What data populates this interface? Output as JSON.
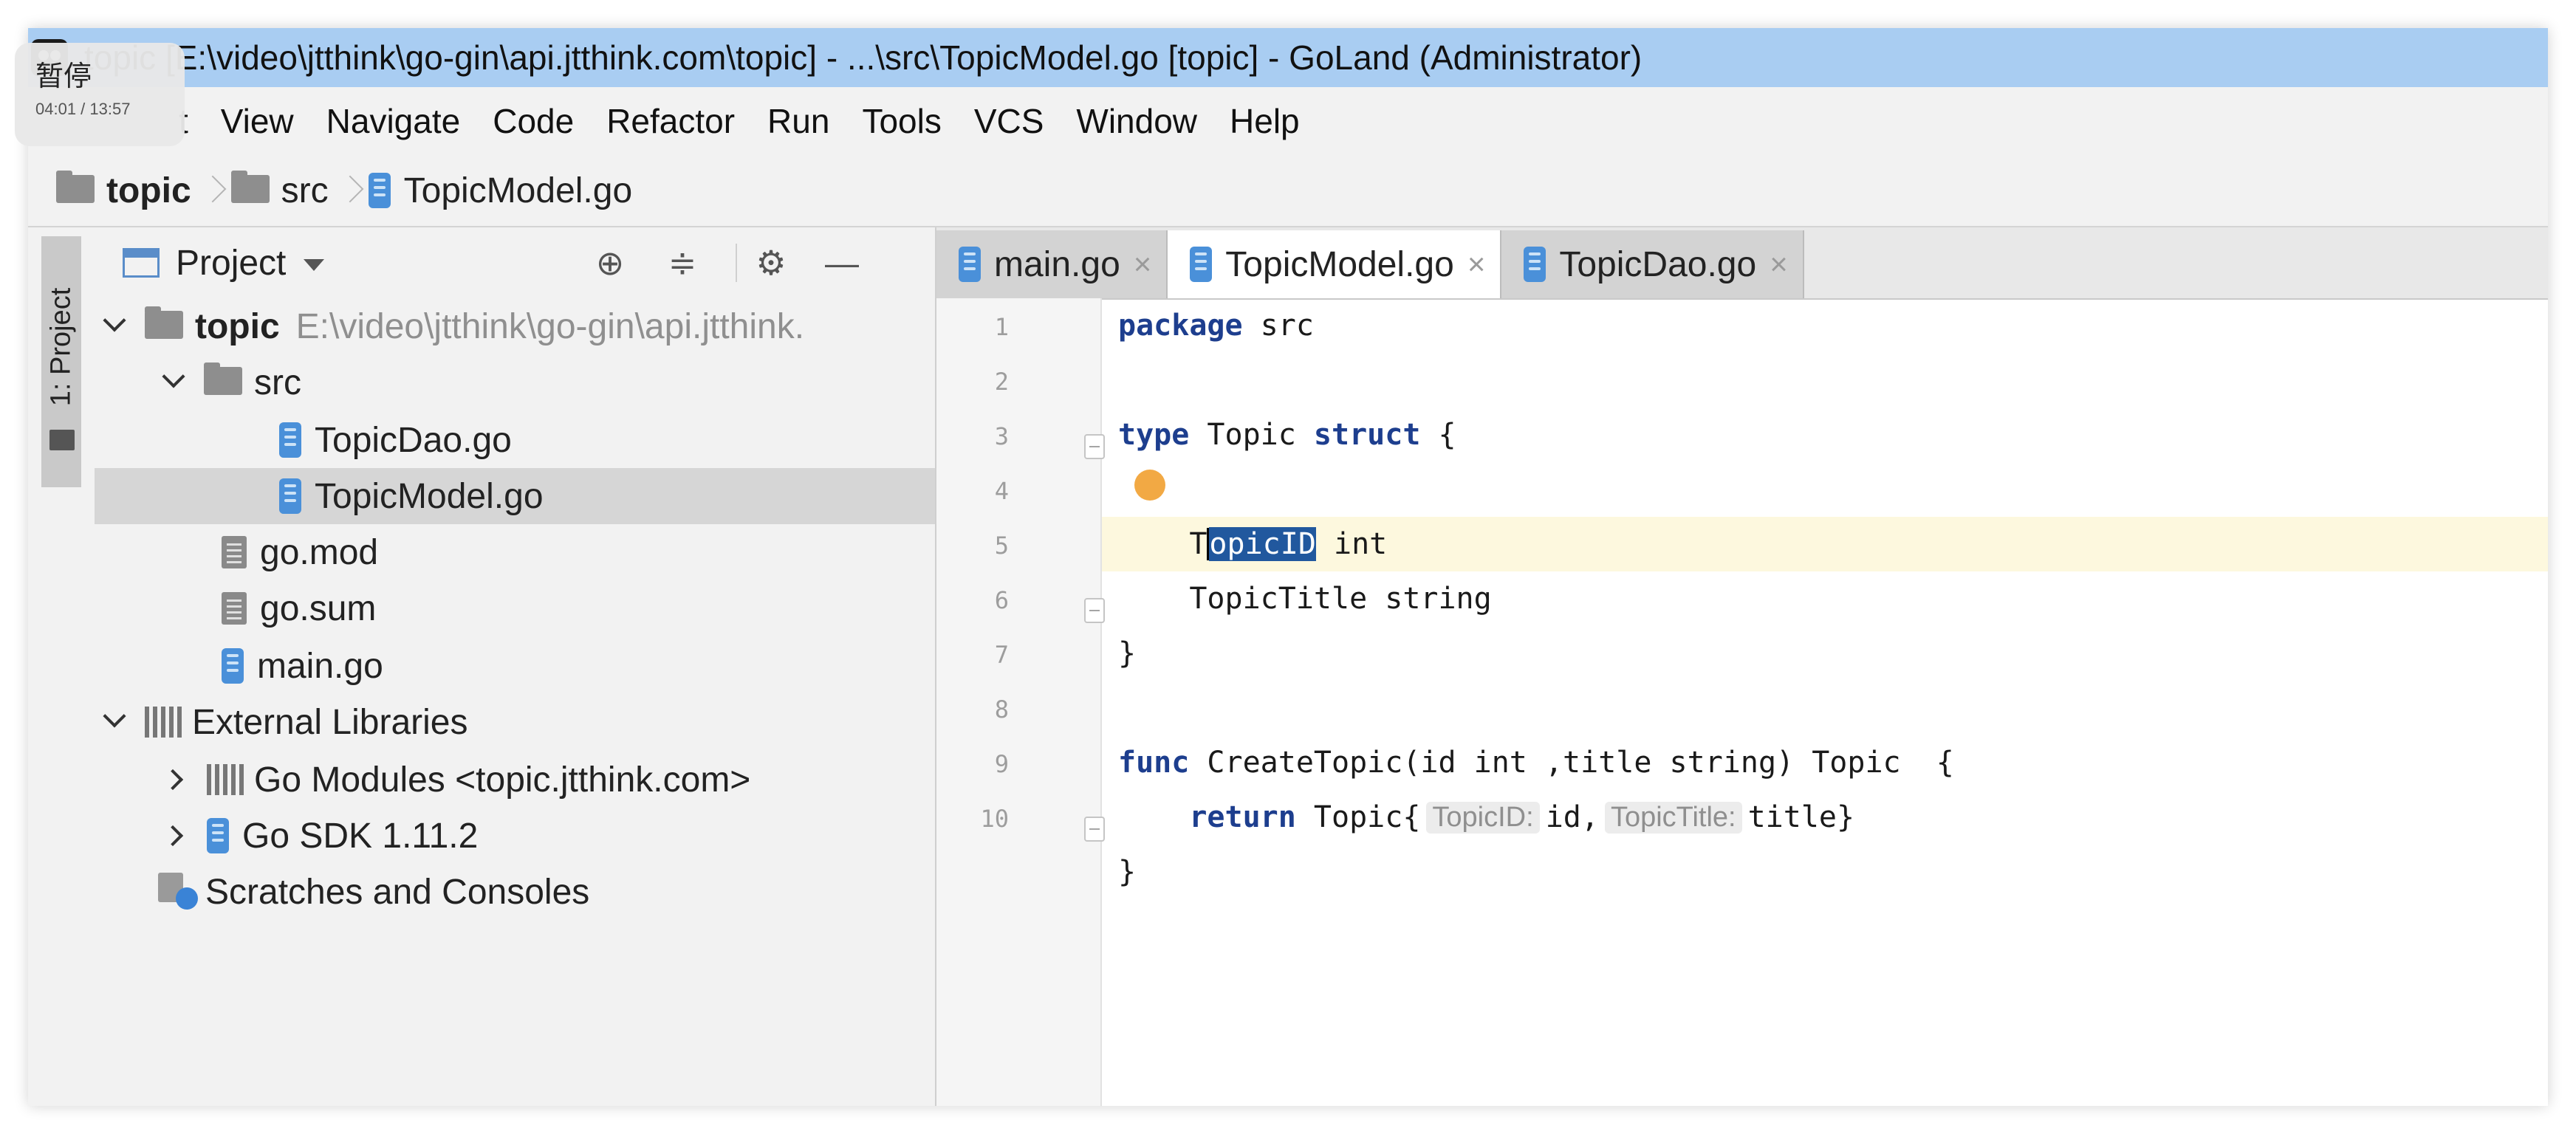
{
  "window": {
    "title": "topic [E:\\video\\jtthink\\go-gin\\api.jtthink.com\\topic] - ...\\src\\TopicModel.go [topic] - GoLand (Administrator)"
  },
  "pause_overlay": {
    "label": "暂停",
    "time": "04:01 / 13:57"
  },
  "menu": {
    "items": [
      "t",
      "View",
      "Navigate",
      "Code",
      "Refactor",
      "Run",
      "Tools",
      "VCS",
      "Window",
      "Help"
    ]
  },
  "breadcrumb": {
    "items": [
      "topic",
      "src",
      "TopicModel.go"
    ]
  },
  "side_strip": {
    "tab_label": "1: Project"
  },
  "project_panel": {
    "title": "Project",
    "tree": [
      {
        "label": "topic",
        "hint": "E:\\video\\jtthink\\go-gin\\api.jtthink.",
        "icon": "folder-icon"
      },
      {
        "label": "src",
        "icon": "folder-icon"
      },
      {
        "label": "TopicDao.go",
        "icon": "go-file-icon"
      },
      {
        "label": "TopicModel.go",
        "icon": "go-file-icon",
        "selected": true
      },
      {
        "label": "go.mod",
        "icon": "text-file-icon"
      },
      {
        "label": "go.sum",
        "icon": "text-file-icon"
      },
      {
        "label": "main.go",
        "icon": "go-file-icon"
      },
      {
        "label": "External Libraries",
        "icon": "library-icon"
      },
      {
        "label": "Go Modules <topic.jtthink.com>",
        "icon": "library-icon"
      },
      {
        "label": "Go SDK 1.11.2",
        "icon": "go-file-icon"
      },
      {
        "label": "Scratches and Consoles",
        "icon": "scratch-icon"
      }
    ]
  },
  "editor": {
    "tabs": [
      {
        "label": "main.go",
        "close": "×",
        "active": false
      },
      {
        "label": "TopicModel.go",
        "close": "×",
        "active": true
      },
      {
        "label": "TopicDao.go",
        "close": "×",
        "active": false
      }
    ],
    "line_numbers": [
      "1",
      "2",
      "3",
      "4",
      "5",
      "6",
      "7",
      "8",
      "9",
      "10"
    ],
    "code": {
      "l1_kw": "package",
      "l1_rest": " src",
      "l3_kw_a": "ty",
      "l3_kw_b": "pe",
      "l3_mid": " Topic ",
      "l3_kw2": "struct",
      "l3_end": " {",
      "l4_indent": "    ",
      "l4_first": "T",
      "l4_sel": "opicID",
      "l4_rest": " int",
      "l5": "    TopicTitle string",
      "l6": "}",
      "l8_kw": "func",
      "l8_rest": " CreateTopic(id int ,title string) Topic  {",
      "l9_indent": "    ",
      "l9_kw": "return",
      "l9_a": " Topic{",
      "l9_hint1": "TopicID:",
      "l9_b": "id,",
      "l9_hint2": "TopicTitle:",
      "l9_c": "title}",
      "l10": "}"
    }
  },
  "colors": {
    "title_bar": "#a9cdf2",
    "keyword": "#1d3e8e",
    "selection": "#21589e",
    "current_line": "#fdf8de",
    "cursor_dot": "#f1a43a"
  }
}
